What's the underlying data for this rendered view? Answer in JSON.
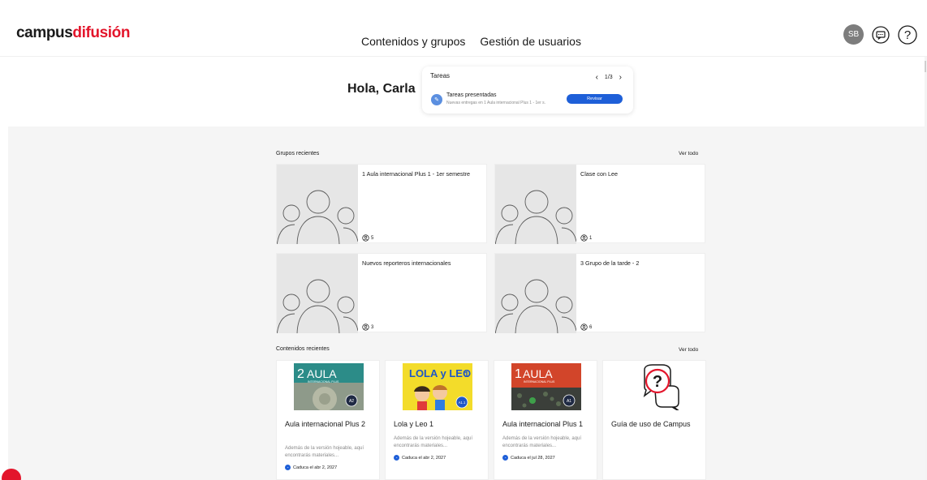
{
  "header": {
    "logo_part1": "campus",
    "logo_part2": "difusión",
    "nav": [
      "Contenidos y grupos",
      "Gestión de usuarios"
    ],
    "avatar_initials": "SB",
    "icons": [
      "chat-icon",
      "help-icon"
    ]
  },
  "greeting": "Hola, Carla",
  "tasks": {
    "title": "Tareas",
    "pager": "1/3",
    "item_title": "Tareas presentadas",
    "item_subtitle": "Nuevas entregas en 1 Aula internacional Plus 1 - 1er s...",
    "button": "Revisar"
  },
  "groups": {
    "title": "Grupos recientes",
    "see_all": "Ver todo",
    "items": [
      {
        "name": "1 Aula internacional Plus 1 - 1er semestre",
        "count": "5"
      },
      {
        "name": "Clase con Lee",
        "count": "1"
      },
      {
        "name": "Nuevos reporteros internacionales",
        "count": "3"
      },
      {
        "name": "3 Grupo de la tarde - 2",
        "count": "6"
      }
    ]
  },
  "contents": {
    "title": "Contenidos recientes",
    "see_all": "Ver todo",
    "items": [
      {
        "title": "Aula internacional Plus 2",
        "desc": "Además de la versión hojeable, aquí encontrarás materiales...",
        "expiry": "Caduca el abr 2, 2027",
        "cover_text": "AULA",
        "cover_num": "2",
        "cover_sub": "INTERNACIONAL PLUS",
        "cover_badge": "A2"
      },
      {
        "title": "Lola y Leo 1",
        "desc": "Además de la versión hojeable, aquí encontrarás materiales...",
        "expiry": "Caduca el abr 2, 2027",
        "cover_text": "LOLA y LEO",
        "cover_num": "1",
        "cover_badge": "A1.1"
      },
      {
        "title": "Aula internacional Plus 1",
        "desc": "Además de la versión hojeable, aquí encontrarás materiales...",
        "expiry": "Caduca el jul 28, 2027",
        "cover_text": "AULA",
        "cover_num": "1",
        "cover_sub": "INTERNACIONAL PLUS",
        "cover_badge": "A1"
      },
      {
        "title": "Guía de uso de Campus",
        "desc": "",
        "expiry": ""
      }
    ]
  },
  "colors": {
    "brand_red": "#e3152b",
    "accent_blue": "#1e5fd8"
  }
}
